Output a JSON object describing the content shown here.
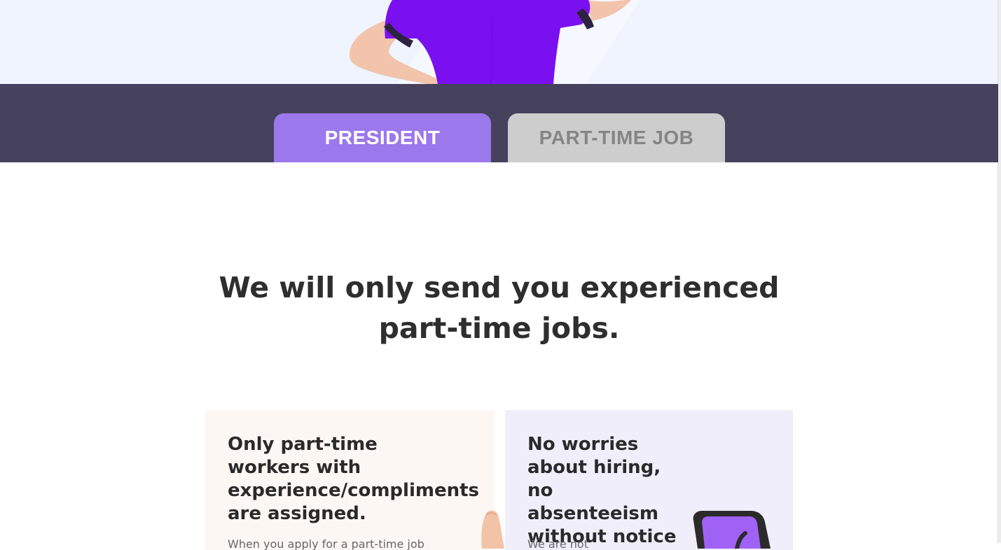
{
  "tabs": {
    "president": "PRESIDENT",
    "part_time_job": "PART-TIME JOB"
  },
  "headline": "We will only send you experienced part-time jobs.",
  "cards": [
    {
      "title": "Only part-time workers with experience/compliments are assigned.",
      "text": "When you apply for a part-time job"
    },
    {
      "title": "No worries about hiring, no absenteeism without notice",
      "text": "We are not"
    }
  ],
  "colors": {
    "accent": "#9b78eb",
    "tab_bar": "#46425d",
    "tab_inactive": "#cdcdcd",
    "shirt": "#7a10f0"
  }
}
